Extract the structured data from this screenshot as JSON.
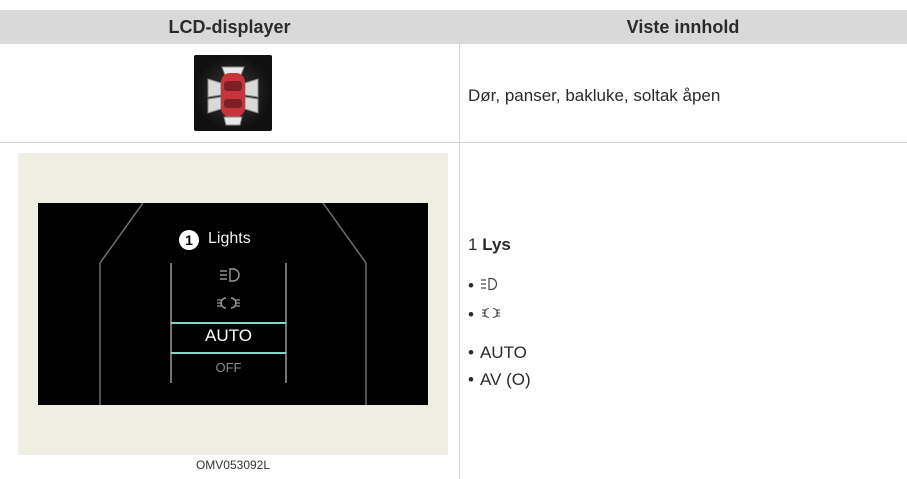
{
  "table": {
    "header": {
      "col1": "LCD-displayer",
      "col2": "Viste innhold"
    },
    "rows": [
      {
        "icon": "car-doors-open-icon",
        "text": "Dør, panser, bakluke, soltak åpen"
      },
      {
        "screen": {
          "badge_number": "1",
          "title": "Lights",
          "options": [
            "AUTO",
            "OFF"
          ],
          "option_icons": [
            "headlight-icon",
            "position-light-icon"
          ],
          "selected": "AUTO"
        },
        "caption": "OMV053092L",
        "content": {
          "number": "1",
          "title": "Lys",
          "items": [
            "AUTO",
            "AV (O)"
          ],
          "item_icons": [
            "headlight-icon",
            "position-light-icon"
          ]
        }
      }
    ]
  }
}
